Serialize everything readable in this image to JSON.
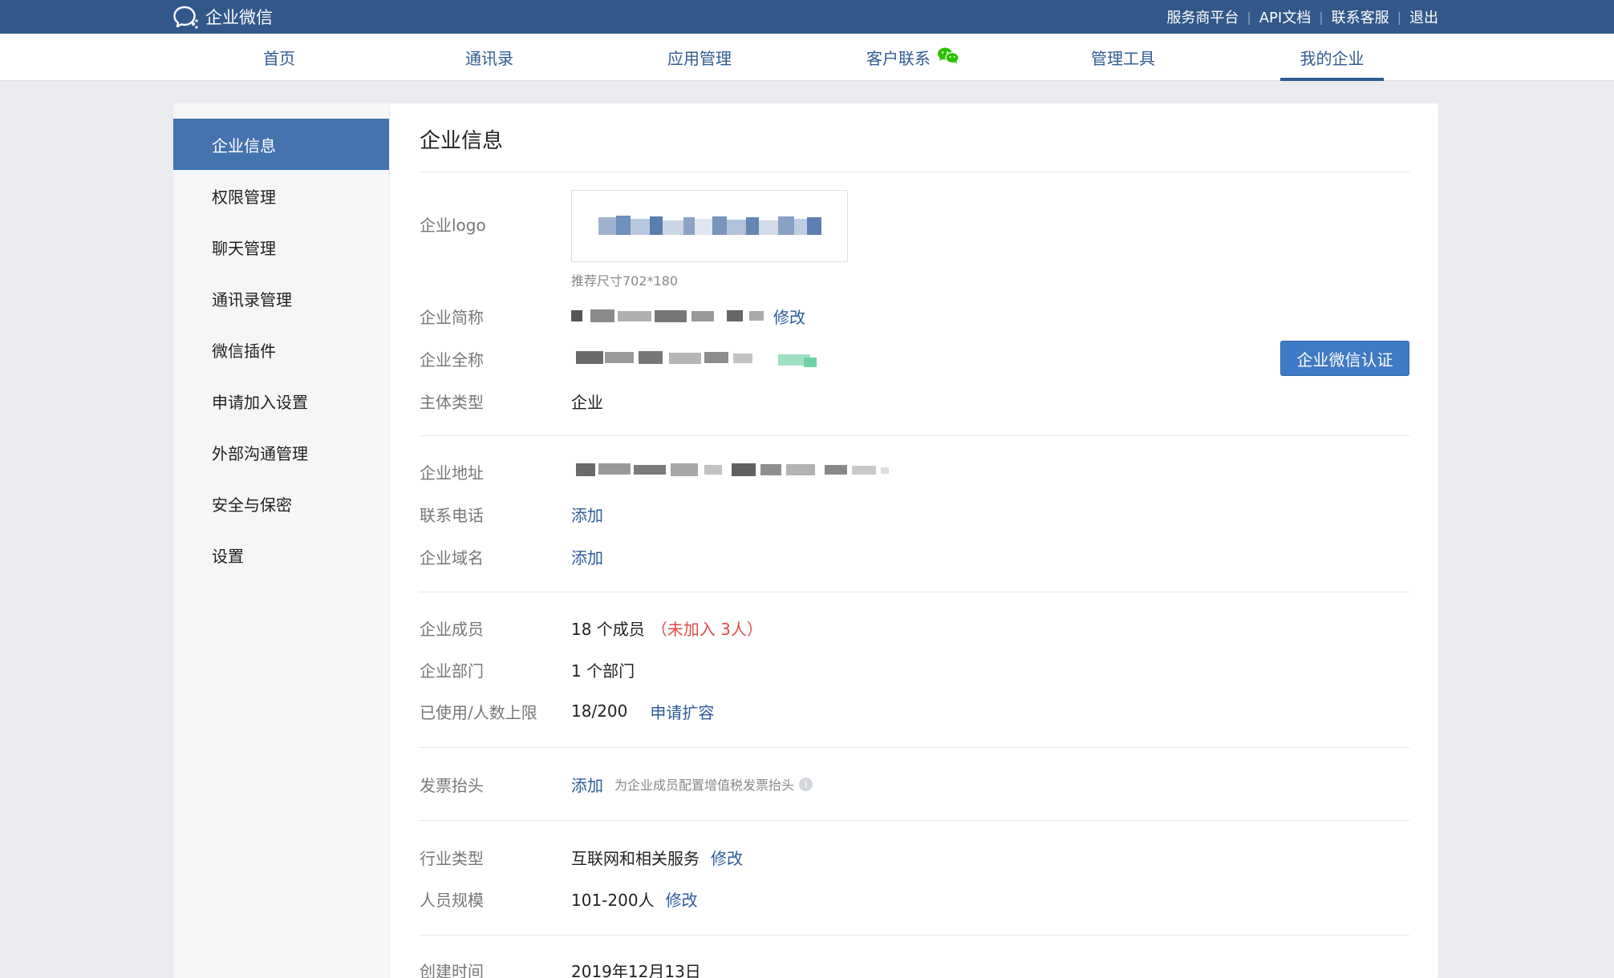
{
  "app": {
    "brand": "企业微信"
  },
  "toplinks": [
    "服务商平台",
    "API文档",
    "联系客服",
    "退出"
  ],
  "nav": [
    {
      "label": "首页"
    },
    {
      "label": "通讯录"
    },
    {
      "label": "应用管理"
    },
    {
      "label": "客户联系"
    },
    {
      "label": "管理工具"
    },
    {
      "label": "我的企业"
    }
  ],
  "sidebar": [
    "企业信息",
    "权限管理",
    "聊天管理",
    "通讯录管理",
    "微信插件",
    "申请加入设置",
    "外部沟通管理",
    "安全与保密",
    "设置"
  ],
  "page": {
    "title": "企业信息",
    "logo_label": "企业logo",
    "logo_hint": "推荐尺寸702*180",
    "short_name_label": "企业简称",
    "short_name_edit": "修改",
    "full_name_label": "企业全称",
    "auth_button": "企业微信认证",
    "entity_label": "主体类型",
    "entity_value": "企业",
    "address_label": "企业地址",
    "phone_label": "联系电话",
    "phone_action": "添加",
    "domain_label": "企业域名",
    "domain_action": "添加",
    "members_label": "企业成员",
    "members_value": "18 个成员",
    "members_unjoined": "（未加入 3人）",
    "depts_label": "企业部门",
    "depts_value": "1 个部门",
    "quota_label": "已使用/人数上限",
    "quota_value": "18/200",
    "quota_action": "申请扩容",
    "invoice_label": "发票抬头",
    "invoice_action": "添加",
    "invoice_hint": "为企业成员配置增值税发票抬头",
    "industry_label": "行业类型",
    "industry_value": "互联网和相关服务",
    "industry_edit": "修改",
    "scale_label": "人员规模",
    "scale_value": "101-200人",
    "scale_edit": "修改",
    "created_label": "创建时间",
    "created_value": "2019年12月13日"
  }
}
